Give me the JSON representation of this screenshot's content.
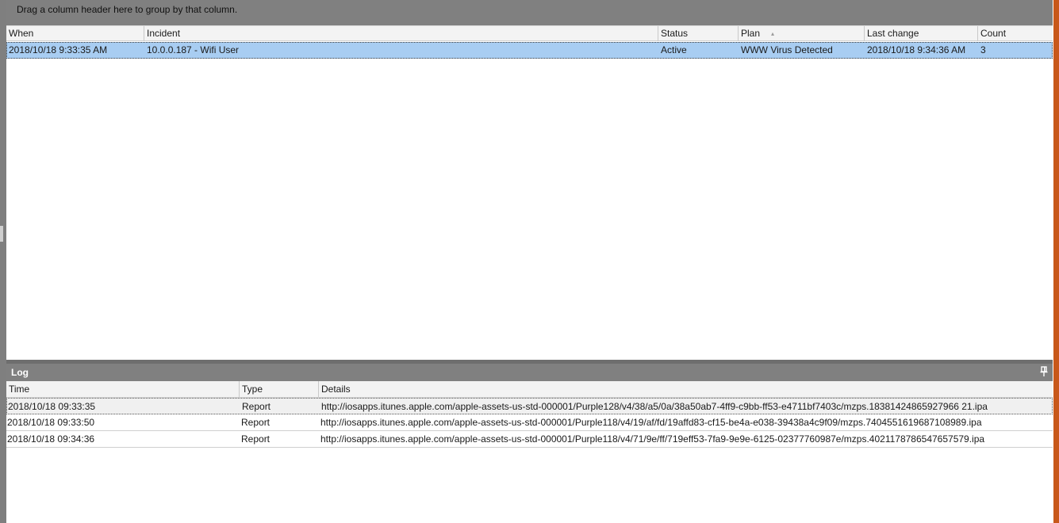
{
  "group_panel": {
    "hint": "Drag a column header here to group by that column."
  },
  "incidents": {
    "columns": [
      "When",
      "Incident",
      "Status",
      "Plan",
      "Last change",
      "Count"
    ],
    "sorted_column": "Plan",
    "rows": [
      {
        "when": "2018/10/18 9:33:35 AM",
        "incident": "10.0.0.187 - Wifi User",
        "status": "Active",
        "plan": "WWW Virus Detected",
        "last_change": "2018/10/18 9:34:36 AM",
        "count": "3"
      }
    ],
    "selected_row_color": "#a8cdf2"
  },
  "log": {
    "title": "Log",
    "columns": [
      "Time",
      "Type",
      "Details"
    ],
    "rows": [
      {
        "time": "2018/10/18 09:33:35",
        "type": "Report",
        "details": "http://iosapps.itunes.apple.com/apple-assets-us-std-000001/Purple128/v4/38/a5/0a/38a50ab7-4ff9-c9bb-ff53-e4711bf7403c/mzps.18381424865927966 21.ipa"
      },
      {
        "time": "2018/10/18 09:33:50",
        "type": "Report",
        "details": "http://iosapps.itunes.apple.com/apple-assets-us-std-000001/Purple118/v4/19/af/fd/19affd83-cf15-be4a-e038-39438a4c9f09/mzps.7404551619687108989.ipa"
      },
      {
        "time": "2018/10/18 09:34:36",
        "type": "Report",
        "details": "http://iosapps.itunes.apple.com/apple-assets-us-std-000001/Purple118/v4/71/9e/ff/719eff53-7fa9-9e9e-6125-02377760987e/mzps.4021178786547657579.ipa"
      }
    ]
  },
  "colors": {
    "accent_bar": "#c8581a",
    "panel_gray": "#808080",
    "header_bg": "#f3f3f3"
  },
  "icons": {
    "pin": "pin-icon",
    "sort": "sort-ascending-icon"
  }
}
